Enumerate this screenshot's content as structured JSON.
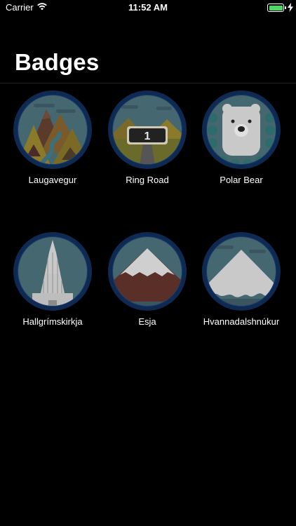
{
  "status_bar": {
    "carrier": "Carrier",
    "time": "11:52 AM",
    "battery_color": "#4cd964"
  },
  "header": {
    "title": "Badges"
  },
  "badges": [
    {
      "label": "Laugavegur",
      "icon": "mountain-trail-badge-icon"
    },
    {
      "label": "Ring Road",
      "icon": "ring-road-sign-badge-icon",
      "sign_text": "1"
    },
    {
      "label": "Polar Bear",
      "icon": "polar-bear-badge-icon"
    },
    {
      "label": "Hallgrímskirkja",
      "icon": "church-tower-badge-icon"
    },
    {
      "label": "Esja",
      "icon": "snowy-mountain-badge-icon"
    },
    {
      "label": "Hvannadalshnúkur",
      "icon": "glacier-peak-badge-icon"
    }
  ],
  "colors": {
    "badge_ring": "#0f2a52",
    "badge_sky": "#45676f"
  }
}
